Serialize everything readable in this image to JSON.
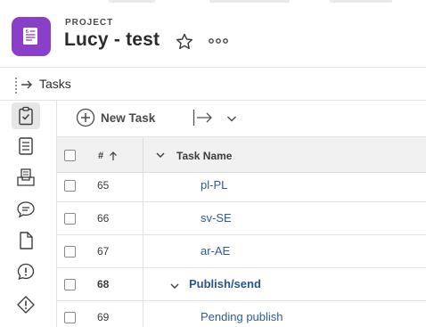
{
  "header": {
    "label": "PROJECT",
    "title": "Lucy - test",
    "icon": "project-document-icon",
    "accent_color": "#8a3fc8"
  },
  "section": {
    "title": "Tasks",
    "icon": "tasks-list-icon"
  },
  "rail": {
    "items": [
      {
        "icon": "tasks-icon",
        "active": true
      },
      {
        "icon": "document-icon",
        "active": false
      },
      {
        "icon": "inbox-icon",
        "active": false
      },
      {
        "icon": "comment-icon",
        "active": false
      },
      {
        "icon": "file-icon",
        "active": false
      },
      {
        "icon": "issue-icon",
        "active": false
      },
      {
        "icon": "risk-icon",
        "active": false
      }
    ]
  },
  "toolbar": {
    "new_task_label": "New Task"
  },
  "table": {
    "headers": {
      "number": "#",
      "name": "Task Name"
    },
    "rows": [
      {
        "number": "65",
        "name": "pl-PL",
        "bold": false,
        "group": false
      },
      {
        "number": "66",
        "name": "sv-SE",
        "bold": false,
        "group": false
      },
      {
        "number": "67",
        "name": "ar-AE",
        "bold": false,
        "group": false
      },
      {
        "number": "68",
        "name": "Publish/send",
        "bold": true,
        "group": true
      },
      {
        "number": "69",
        "name": "Pending publish",
        "bold": false,
        "group": false
      }
    ]
  },
  "colors": {
    "link": "#2f5c97",
    "rail_active": "#e6e6e6"
  }
}
